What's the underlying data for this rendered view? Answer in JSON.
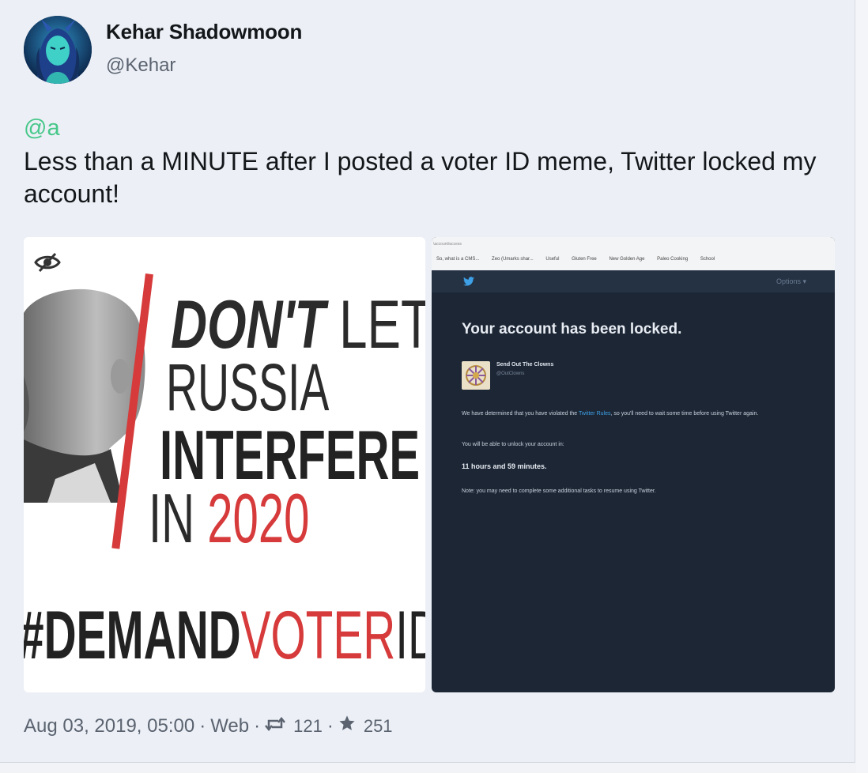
{
  "author": {
    "display_name": "Kehar Shadowmoon",
    "handle": "@Kehar"
  },
  "post": {
    "mention": "@a",
    "text": "Less than a MINUTE after I posted a voter ID meme, Twitter locked my account!"
  },
  "media": [
    {
      "kind": "meme-image",
      "lines": {
        "line1_bold": "DON'T",
        "line1_thin": " LET",
        "line2": "RUSSIA",
        "line3": "INTERFERE",
        "line4_dark": "IN ",
        "line4_red": "2020",
        "line5_dark": "#DEMAND",
        "line5_red": "VOTER",
        "line5_thin": "ID"
      }
    },
    {
      "kind": "screenshot",
      "browser_url": "\\account/access",
      "bookmarks": [
        "So, what is a CMS...",
        "Zeo (Umarks shar...",
        "Useful",
        "Gluten Free",
        "New Golden Age",
        "Paleo Cooking",
        "School"
      ],
      "options_label": "Options ▾",
      "title": "Your account has been locked.",
      "account_name": "Send Out The Clowns",
      "account_handle": "@OutClowns",
      "body_before_link": "We have determined that you have violated the ",
      "body_link": "Twitter Rules",
      "body_after_link": ", so you'll need to wait some time before using Twitter again.",
      "unlock_intro": "You will be able to unlock your account in:",
      "unlock_time": "11 hours and 59 minutes.",
      "note": "Note: you may need to complete some additional tasks to resume using Twitter."
    }
  ],
  "meta": {
    "timestamp": "Aug 03, 2019, 05:00",
    "source": "Web",
    "separator": "·",
    "repeat_count": "121",
    "favourite_count": "251"
  },
  "colors": {
    "accent_green": "#47c78a",
    "meme_red": "#d63a3a",
    "locked_bg": "#1c2635"
  },
  "icons": [
    "hide-media-icon",
    "repeat-icon",
    "star-icon",
    "twitter-bird-icon"
  ]
}
